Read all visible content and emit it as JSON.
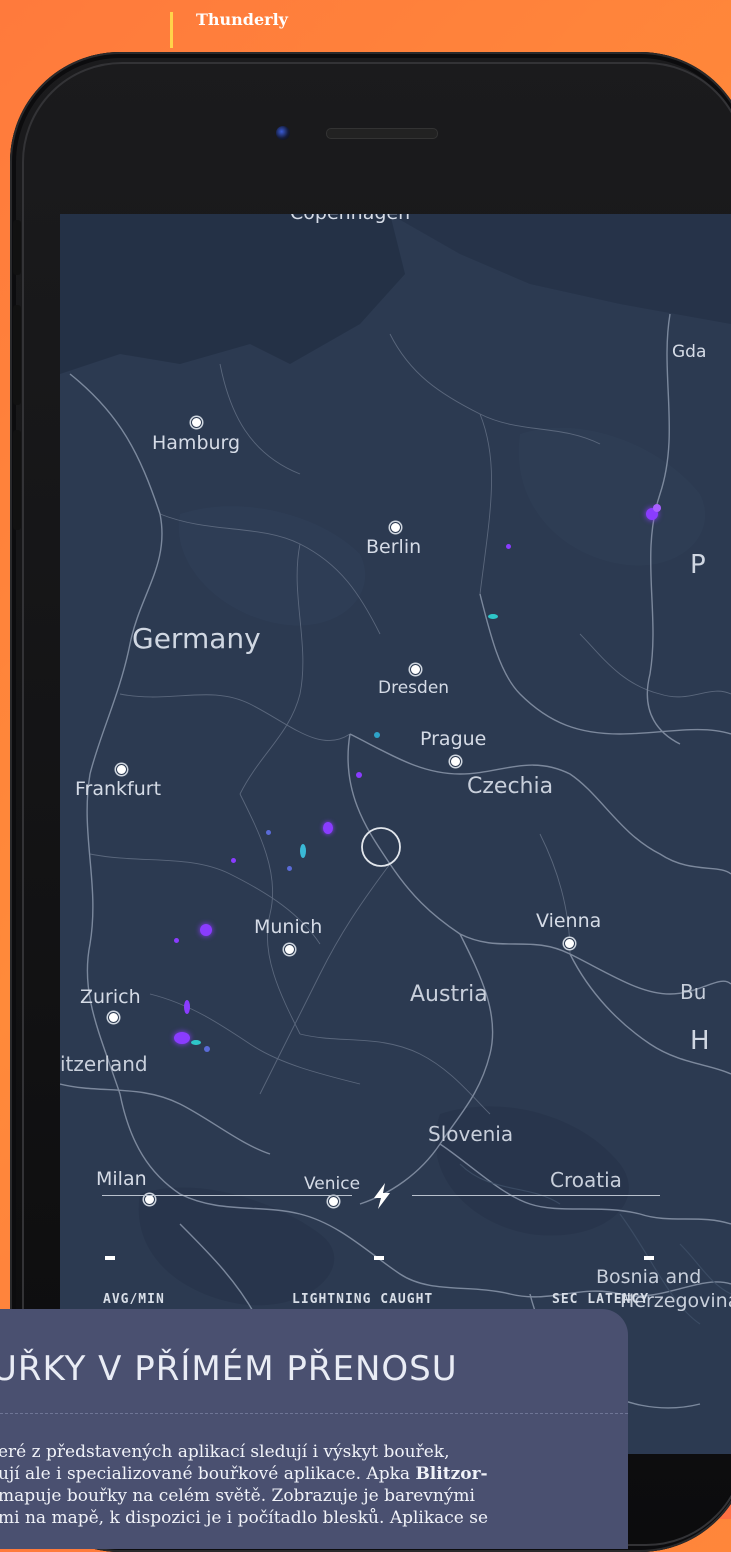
{
  "header": {
    "label": "Thunderly"
  },
  "map": {
    "cities": {
      "copenhagen": "Copenhagen",
      "hamburg": "Hamburg",
      "berlin": "Berlin",
      "dresden": "Dresden",
      "prague": "Prague",
      "frankfurt": "Frankfurt",
      "munich": "Munich",
      "vienna": "Vienna",
      "zurich": "Zurich",
      "milan": "Milan",
      "venice": "Venice",
      "gdansk_partial": "Gda"
    },
    "countries": {
      "germany": "Germany",
      "czechia": "Czechia",
      "austria": "Austria",
      "switzerland_partial": "itzerland",
      "slovenia": "Slovenia",
      "croatia": "Croatia",
      "bosnia_line1": "Bosnia and",
      "bosnia_line2": "Herzegovina",
      "poland_partial": "P",
      "budapest_partial": "Bu",
      "hungary_partial": "H"
    }
  },
  "stats": {
    "avg": {
      "value": "-",
      "label": "AVG/MIN"
    },
    "caught": {
      "value": "-",
      "label": "LIGHTNING CAUGHT"
    },
    "latency": {
      "value": "-",
      "label": "SEC LATENCY"
    }
  },
  "article": {
    "title": "UŘKY V PŘÍMÉM PŘENOSU",
    "line1": "eré z představených aplikací sledují i výskyt bouřek,",
    "line2_a": "ují ale i specializované bouřkové aplikace. Apka ",
    "line2_b": "Blitzor-",
    "line3": "mapuje bouřky na celém světě. Zobrazuje je barevnými",
    "line4": "mi na mapě, k dispozici je i počítadlo blesků. Aplikace se"
  },
  "colors": {
    "background": "#ff7a3c",
    "map": "#2c3a51",
    "card": "#4a5070",
    "strike_purple": "#8a3cff",
    "strike_cyan": "#2ec6c9"
  }
}
